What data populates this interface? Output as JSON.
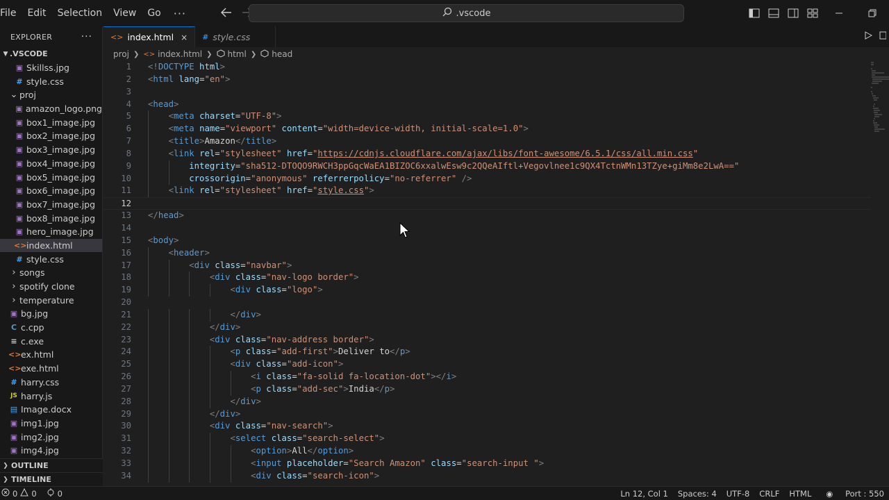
{
  "menu": [
    "File",
    "Edit",
    "Selection",
    "View",
    "Go"
  ],
  "menu_more": "···",
  "command_center": ".vscode",
  "icons": {
    "back": "arrow-left-icon",
    "forward": "arrow-right-icon",
    "search": "search-icon"
  },
  "sidebar": {
    "title": "EXPLORER",
    "more": "···",
    "root": ".VSCODE",
    "items": [
      {
        "label": "Skillss.jpg",
        "kind": "img",
        "indent": 1
      },
      {
        "label": "style.css",
        "kind": "css",
        "indent": 1
      },
      {
        "label": "proj",
        "kind": "folder-open",
        "indent": 0
      },
      {
        "label": "amazon_logo.png",
        "kind": "img",
        "indent": 1
      },
      {
        "label": "box1_image.jpg",
        "kind": "img",
        "indent": 1
      },
      {
        "label": "box2_image.jpg",
        "kind": "img",
        "indent": 1
      },
      {
        "label": "box3_image.jpg",
        "kind": "img",
        "indent": 1
      },
      {
        "label": "box4_image.jpg",
        "kind": "img",
        "indent": 1
      },
      {
        "label": "box5_image.jpg",
        "kind": "img",
        "indent": 1
      },
      {
        "label": "box6_image.jpg",
        "kind": "img",
        "indent": 1
      },
      {
        "label": "box7_image.jpg",
        "kind": "img",
        "indent": 1
      },
      {
        "label": "box8_image.jpg",
        "kind": "img",
        "indent": 1
      },
      {
        "label": "hero_image.jpg",
        "kind": "img",
        "indent": 1
      },
      {
        "label": "index.html",
        "kind": "html",
        "indent": 1,
        "selected": true
      },
      {
        "label": "style.css",
        "kind": "css",
        "indent": 1
      },
      {
        "label": "songs",
        "kind": "folder",
        "indent": 0
      },
      {
        "label": "spotify clone",
        "kind": "folder",
        "indent": 0
      },
      {
        "label": "temperature",
        "kind": "folder",
        "indent": 0
      },
      {
        "label": "bg.jpg",
        "kind": "img",
        "indent": 0
      },
      {
        "label": "c.cpp",
        "kind": "cpp",
        "indent": 0
      },
      {
        "label": "c.exe",
        "kind": "exe",
        "indent": 0
      },
      {
        "label": "ex.html",
        "kind": "html",
        "indent": 0
      },
      {
        "label": "exe.html",
        "kind": "html",
        "indent": 0
      },
      {
        "label": "harry.css",
        "kind": "css",
        "indent": 0
      },
      {
        "label": "harry.js",
        "kind": "js",
        "indent": 0
      },
      {
        "label": "Image.docx",
        "kind": "doc",
        "indent": 0
      },
      {
        "label": "img1.jpg",
        "kind": "img",
        "indent": 0
      },
      {
        "label": "img2.jpg",
        "kind": "img",
        "indent": 0
      },
      {
        "label": "img4.jpg",
        "kind": "img",
        "indent": 0
      }
    ],
    "outline": "OUTLINE",
    "timeline": "TIMELINE"
  },
  "tabs": [
    {
      "label": "index.html",
      "active": true,
      "kind": "html",
      "close": "×"
    },
    {
      "label": "style.css",
      "active": false,
      "kind": "css"
    }
  ],
  "breadcrumb": [
    "proj",
    "index.html",
    "html",
    "head"
  ],
  "code_lines": [
    "<!DOCTYPE html>",
    "<html lang=\"en\">",
    "",
    "<head>",
    "    <meta charset=\"UTF-8\">",
    "    <meta name=\"viewport\" content=\"width=device-width, initial-scale=1.0\">",
    "    <title>Amazon</title>",
    "    <link rel=\"stylesheet\" href=\"https://cdnjs.cloudflare.com/ajax/libs/font-awesome/6.5.1/css/all.min.css\"",
    "        integrity=\"sha512-DTOQO9RWCH3ppGqcWaEA1BIZOC6xxalwEsw9c2QQeAIftl+Vegovlnee1c9QX4TctnWMn13TZye+giMm8e2LwA==\"",
    "        crossorigin=\"anonymous\" referrerpolicy=\"no-referrer\" />",
    "    <link rel=\"stylesheet\" href=\"style.css\">",
    "",
    "</head>",
    "",
    "<body>",
    "    <header>",
    "        <div class=\"navbar\">",
    "            <div class=\"nav-logo border\">",
    "                <div class=\"logo\">",
    "",
    "                </div>",
    "            </div>",
    "            <div class=\"nav-address border\">",
    "                <p class=\"add-first\">Deliver to</p>",
    "                <div class=\"add-icon\">",
    "                    <i class=\"fa-solid fa-location-dot\"></i>",
    "                    <p class=\"add-sec\">India</p>",
    "                </div>",
    "            </div>",
    "            <div class=\"nav-search\">",
    "                <select class=\"search-select\">",
    "                    <option>All</option>",
    "                    <input placeholder=\"Search Amazon\" class=\"search-input \">",
    "                    <div class=\"search-icon\">"
  ],
  "current_line": 12,
  "status": {
    "errors": "0",
    "warnings": "0",
    "ports": "0",
    "position": "Ln 12, Col 1",
    "spaces": "Spaces: 4",
    "encoding": "UTF-8",
    "eol": "CRLF",
    "language": "HTML",
    "port": "Port : 550"
  }
}
